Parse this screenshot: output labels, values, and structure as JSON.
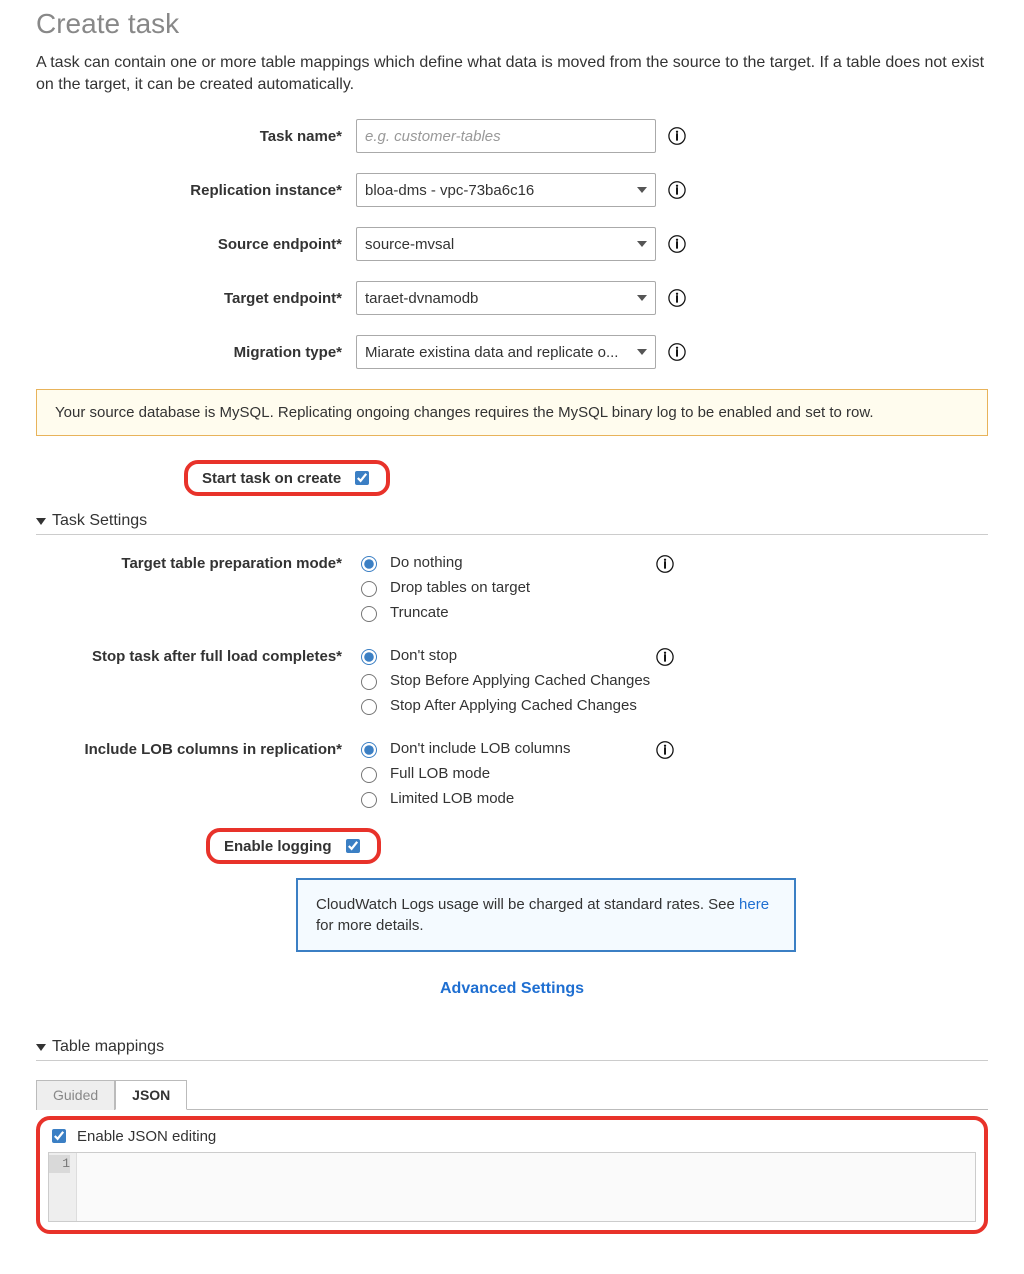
{
  "page": {
    "title": "Create task",
    "intro": "A task can contain one or more table mappings which define what data is moved from the source to the target. If a table does not exist on the target, it can be created automatically."
  },
  "form": {
    "task_name": {
      "label": "Task name*",
      "placeholder": "e.g. customer-tables",
      "value": ""
    },
    "replication_instance": {
      "label": "Replication instance*",
      "value": "bloa-dms - vpc-73ba6c16"
    },
    "source_endpoint": {
      "label": "Source endpoint*",
      "value": "source-mvsal"
    },
    "target_endpoint": {
      "label": "Target endpoint*",
      "value": "taraet-dvnamodb"
    },
    "migration_type": {
      "label": "Migration type*",
      "value": "Miarate existina data and replicate o..."
    }
  },
  "warning": "Your source database is MySQL. Replicating ongoing changes requires the MySQL binary log to be enabled and set to row.",
  "start_task": {
    "label": "Start task on create",
    "checked": true
  },
  "sections": {
    "task_settings": "Task Settings",
    "table_mappings": "Table mappings"
  },
  "settings": {
    "prep_mode": {
      "label": "Target table preparation mode*",
      "options": [
        "Do nothing",
        "Drop tables on target",
        "Truncate"
      ],
      "selected": 0
    },
    "stop_task": {
      "label": "Stop task after full load completes*",
      "options": [
        "Don't stop",
        "Stop Before Applying Cached Changes",
        "Stop After Applying Cached Changes"
      ],
      "selected": 0
    },
    "lob": {
      "label": "Include LOB columns in replication*",
      "options": [
        "Don't include LOB columns",
        "Full LOB mode",
        "Limited LOB mode"
      ],
      "selected": 0
    },
    "enable_logging": {
      "label": "Enable logging",
      "checked": true
    }
  },
  "cloudwatch_note": {
    "text": "CloudWatch Logs usage will be charged at standard rates. See ",
    "link_text": "here",
    "tail": " for more details."
  },
  "advanced_link": "Advanced Settings",
  "table_mappings": {
    "tabs": [
      "Guided",
      "JSON"
    ],
    "active_tab": 1,
    "enable_json_label": "Enable JSON editing",
    "enable_json_checked": true,
    "line_no": "1"
  }
}
